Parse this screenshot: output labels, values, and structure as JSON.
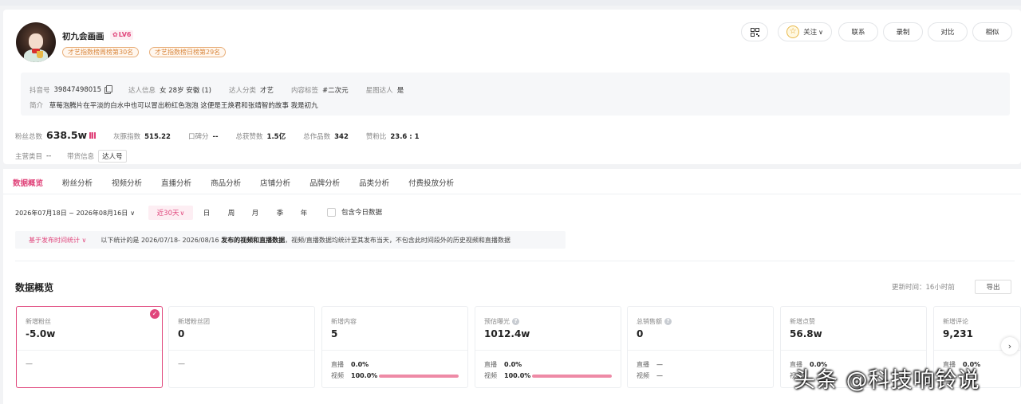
{
  "profile": {
    "name": "初九会画画",
    "level": "LV6",
    "rank_tags": [
      "才艺指数榜周榜第30名",
      "才艺指数榜日榜第29名"
    ]
  },
  "actions": {
    "follow_label": "关注",
    "contact_label": "联系",
    "record_label": "录制",
    "compare_label": "对比",
    "similar_label": "相似"
  },
  "info": {
    "douyin_id_label": "抖音号",
    "douyin_id": "39847498015",
    "creator_info_label": "达人信息",
    "creator_info": "女 28岁 安徽 (1)",
    "category_label": "达人分类",
    "category": "才艺",
    "content_tag_label": "内容标签",
    "content_tag": "#二次元",
    "star_label": "星图达人",
    "star_value": "是",
    "intro_label": "简介",
    "intro": "草莓泡腾片在平淡的白水中也可以冒出粉红色泡泡 这便是王焕君和张靖智的故事 我是初九"
  },
  "stats": {
    "fans_label": "粉丝总数",
    "fans": "638.5w",
    "grey_index_label": "灰豚指数",
    "grey_index": "515.22",
    "reputation_label": "口碑分",
    "reputation": "--",
    "likes_label": "总获赞数",
    "likes": "1.5亿",
    "works_label": "总作品数",
    "works": "342",
    "like_fan_ratio_label": "赞粉比",
    "like_fan_ratio": "23.6 : 1"
  },
  "category_row": {
    "main_cat_label": "主营类目",
    "main_cat": "--",
    "goods_info_label": "带货信息",
    "goods_tag": "达人号"
  },
  "tabs": [
    "数据概览",
    "粉丝分析",
    "视频分析",
    "直播分析",
    "商品分析",
    "店铺分析",
    "品牌分析",
    "品类分析",
    "付费投放分析"
  ],
  "filters": {
    "date_range": "2026年07月18日 ~ 2026年08月16日",
    "recent": "近30天",
    "day": "日",
    "week": "周",
    "month": "月",
    "quarter": "季",
    "year": "年",
    "include_today": "包含今日数据"
  },
  "notice": {
    "basis": "基于发布时间统计",
    "text_prefix": "以下统计的是 2026/07/18- 2026/08/16",
    "text_bold": "发布的视频和直播数据",
    "text_suffix": "，视频/直播数据均统计至其发布当天，不包含此时间段外的历史视频和直播数据"
  },
  "overview": {
    "title": "数据概览",
    "updated": "更新时间：16小时前",
    "export": "导出"
  },
  "metrics": [
    {
      "label": "新增粉丝",
      "value": "-5.0w",
      "dash": "—"
    },
    {
      "label": "新增粉丝团",
      "value": "0",
      "dash": "—"
    },
    {
      "label": "新增内容",
      "value": "5",
      "live_label": "直播",
      "live": "0.0%",
      "video_label": "视频",
      "video": "100.0%",
      "video_fill": 1.0
    },
    {
      "label": "预估曝光",
      "value": "1012.4w",
      "live_label": "直播",
      "live": "0.0%",
      "video_label": "视频",
      "video": "100.0%",
      "video_fill": 1.0
    },
    {
      "label": "总销售额",
      "value": "0",
      "live_label": "直播",
      "live": "—",
      "video_label": "视频",
      "video": "—"
    },
    {
      "label": "新增点赞",
      "value": "56.8w",
      "live_label": "直播",
      "live": "0.0%",
      "video_label": "视频"
    },
    {
      "label": "新增评论",
      "value": "9,231",
      "live_label": "直播",
      "live": "0.0%"
    }
  ],
  "watermark": "头条 @科技响铃说",
  "colors": {
    "accent": "#e0457b",
    "bar": "#ee8aa6",
    "rank": "#d9873e"
  }
}
